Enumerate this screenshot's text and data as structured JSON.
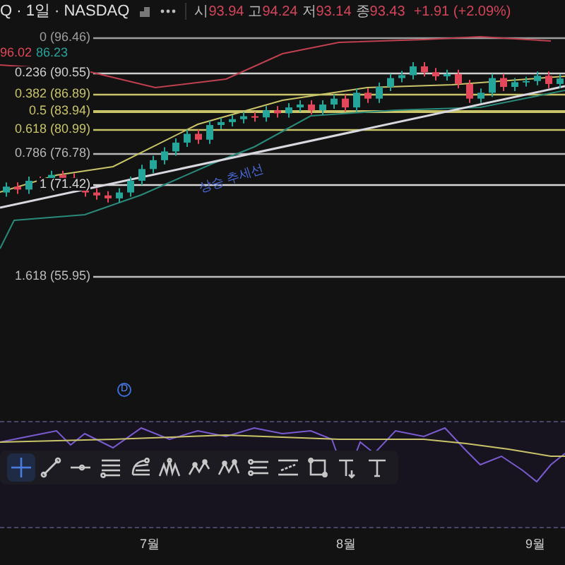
{
  "header": {
    "symbol": "Q · 1일 · NASDAQ",
    "ohlc": [
      {
        "label": "시",
        "value": "93.94"
      },
      {
        "label": "고",
        "value": "94.24"
      },
      {
        "label": "저",
        "value": "93.14"
      },
      {
        "label": "종",
        "value": "93.43"
      }
    ],
    "change": "+1.91 (+2.09%)"
  },
  "indicator_values": [
    {
      "text": "96.02",
      "color": "#e2475a"
    },
    {
      "text": "86.23",
      "color": "#26a69a"
    }
  ],
  "fib_levels": [
    {
      "label": "0 (96.46)",
      "color": "#9e9e9e"
    },
    {
      "label": "0.236 (90.55)",
      "color": "#cfcfcf"
    },
    {
      "label": "0.382 (86.89)",
      "color": "#c9c46a"
    },
    {
      "label": "0.5 (83.94)",
      "color": "#c9c46a"
    },
    {
      "label": "0.618 (80.99)",
      "color": "#c9c46a"
    },
    {
      "label": "0.786 (76.78)",
      "color": "#b8b8b8"
    },
    {
      "label": "1 (71.42)",
      "color": "#d8d8d8"
    },
    {
      "label": "1.618 (55.95)",
      "color": "#bdbdbd"
    }
  ],
  "annotations": [
    {
      "text": "상승 추세선"
    }
  ],
  "dividend_marker": "D",
  "toolbar": [
    {
      "kind": "crosshair",
      "selected": true
    },
    {
      "kind": "trendline",
      "selected": false
    },
    {
      "kind": "hline",
      "selected": false
    },
    {
      "kind": "fib",
      "selected": false
    },
    {
      "kind": "fan",
      "selected": false
    },
    {
      "kind": "pattern",
      "selected": false
    },
    {
      "kind": "wave15",
      "selected": false
    },
    {
      "kind": "waveac",
      "selected": false
    },
    {
      "kind": "channel",
      "selected": false
    },
    {
      "kind": "channel2",
      "selected": false
    },
    {
      "kind": "rect",
      "selected": false
    },
    {
      "kind": "textnote",
      "selected": false
    },
    {
      "kind": "text",
      "selected": false
    }
  ],
  "x_axis": [
    "7월",
    "8월",
    "9월"
  ]
}
